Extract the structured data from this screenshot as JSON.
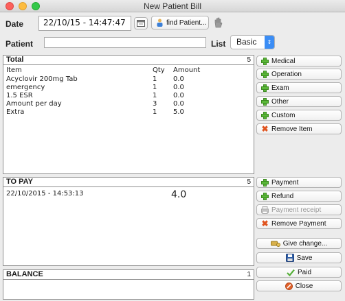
{
  "window": {
    "title": "New Patient Bill"
  },
  "header": {
    "date_label": "Date",
    "date_value": "22/10/15 - 14:47:47",
    "find_patient_label": "find Patient...",
    "patient_label": "Patient",
    "patient_value": "",
    "list_label": "List",
    "list_selected": "Basic"
  },
  "total": {
    "title": "Total",
    "count": "5",
    "columns": [
      "Item",
      "Qty",
      "Amount"
    ],
    "rows": [
      {
        "item": "Acyclovir 200mg Tab",
        "qty": "1",
        "amount": "0.0"
      },
      {
        "item": "emergency",
        "qty": "1",
        "amount": "0.0"
      },
      {
        "item": "1.5 ESR",
        "qty": "1",
        "amount": "0.0"
      },
      {
        "item": "Amount per day",
        "qty": "3",
        "amount": "0.0"
      },
      {
        "item": "Extra",
        "qty": "1",
        "amount": "5.0"
      }
    ]
  },
  "item_buttons": {
    "medical": "Medical",
    "operation": "Operation",
    "exam": "Exam",
    "other": "Other",
    "custom": "Custom",
    "remove_item": "Remove Item"
  },
  "to_pay": {
    "title": "TO PAY",
    "count": "5",
    "payment_date": "22/10/2015 - 14:53:13",
    "payment_amount": "4.0"
  },
  "payment_buttons": {
    "payment": "Payment",
    "refund": "Refund",
    "payment_receipt": "Payment receipt",
    "remove_payment": "Remove Payment"
  },
  "actions": {
    "give_change": "Give change...",
    "save": "Save",
    "paid": "Paid",
    "close": "Close"
  },
  "balance": {
    "title": "BALANCE",
    "count": "1"
  },
  "colors": {
    "add_green": "#5ab838",
    "remove_orange": "#e0541f",
    "select_blue": "#3b8df5"
  }
}
